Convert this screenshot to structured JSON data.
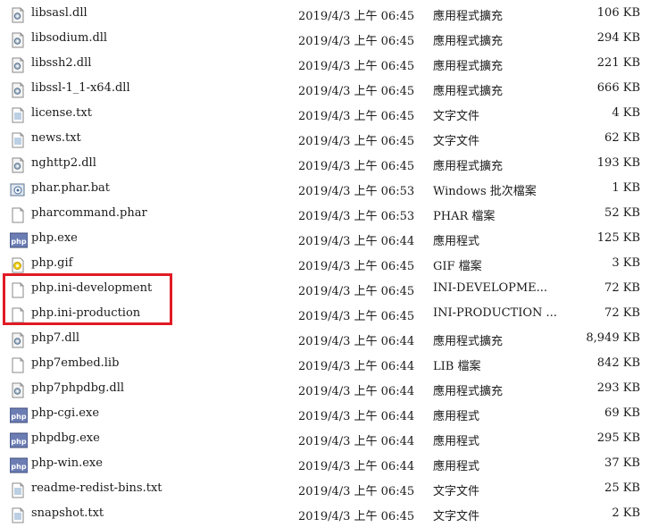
{
  "annotation": {
    "color": "#e01b24",
    "label": "highlight-box"
  },
  "files": [
    {
      "name": "libsasl.dll",
      "date": "2019/4/3 上午 06:45",
      "type": "應用程式擴充",
      "size": "106 KB",
      "icon": "dll-icon"
    },
    {
      "name": "libsodium.dll",
      "date": "2019/4/3 上午 06:45",
      "type": "應用程式擴充",
      "size": "294 KB",
      "icon": "dll-icon"
    },
    {
      "name": "libssh2.dll",
      "date": "2019/4/3 上午 06:45",
      "type": "應用程式擴充",
      "size": "221 KB",
      "icon": "dll-icon"
    },
    {
      "name": "libssl-1_1-x64.dll",
      "date": "2019/4/3 上午 06:45",
      "type": "應用程式擴充",
      "size": "666 KB",
      "icon": "dll-icon"
    },
    {
      "name": "license.txt",
      "date": "2019/4/3 上午 06:45",
      "type": "文字文件",
      "size": "4 KB",
      "icon": "text-file-icon"
    },
    {
      "name": "news.txt",
      "date": "2019/4/3 上午 06:45",
      "type": "文字文件",
      "size": "62 KB",
      "icon": "text-file-icon"
    },
    {
      "name": "nghttp2.dll",
      "date": "2019/4/3 上午 06:45",
      "type": "應用程式擴充",
      "size": "193 KB",
      "icon": "dll-icon"
    },
    {
      "name": "phar.phar.bat",
      "date": "2019/4/3 上午 06:53",
      "type": "Windows 批次檔案",
      "size": "1 KB",
      "icon": "batch-file-icon"
    },
    {
      "name": "pharcommand.phar",
      "date": "2019/4/3 上午 06:53",
      "type": "PHAR 檔案",
      "size": "52 KB",
      "icon": "blank-file-icon"
    },
    {
      "name": "php.exe",
      "date": "2019/4/3 上午 06:44",
      "type": "應用程式",
      "size": "125 KB",
      "icon": "php-exe-icon"
    },
    {
      "name": "php.gif",
      "date": "2019/4/3 上午 06:45",
      "type": "GIF 檔案",
      "size": "3 KB",
      "icon": "gif-image-icon"
    },
    {
      "name": "php.ini-development",
      "date": "2019/4/3 上午 06:45",
      "type": "INI-DEVELOPME...",
      "size": "72 KB",
      "icon": "blank-file-icon"
    },
    {
      "name": "php.ini-production",
      "date": "2019/4/3 上午 06:45",
      "type": "INI-PRODUCTION ...",
      "size": "72 KB",
      "icon": "blank-file-icon"
    },
    {
      "name": "php7.dll",
      "date": "2019/4/3 上午 06:44",
      "type": "應用程式擴充",
      "size": "8,949 KB",
      "icon": "dll-icon"
    },
    {
      "name": "php7embed.lib",
      "date": "2019/4/3 上午 06:44",
      "type": "LIB 檔案",
      "size": "842 KB",
      "icon": "blank-file-icon"
    },
    {
      "name": "php7phpdbg.dll",
      "date": "2019/4/3 上午 06:44",
      "type": "應用程式擴充",
      "size": "293 KB",
      "icon": "dll-icon"
    },
    {
      "name": "php-cgi.exe",
      "date": "2019/4/3 上午 06:44",
      "type": "應用程式",
      "size": "69 KB",
      "icon": "php-exe-icon"
    },
    {
      "name": "phpdbg.exe",
      "date": "2019/4/3 上午 06:44",
      "type": "應用程式",
      "size": "295 KB",
      "icon": "php-exe-icon"
    },
    {
      "name": "php-win.exe",
      "date": "2019/4/3 上午 06:44",
      "type": "應用程式",
      "size": "37 KB",
      "icon": "php-exe-icon"
    },
    {
      "name": "readme-redist-bins.txt",
      "date": "2019/4/3 上午 06:45",
      "type": "文字文件",
      "size": "25 KB",
      "icon": "text-file-icon"
    },
    {
      "name": "snapshot.txt",
      "date": "2019/4/3 上午 06:45",
      "type": "文字文件",
      "size": "2 KB",
      "icon": "text-file-icon"
    }
  ]
}
